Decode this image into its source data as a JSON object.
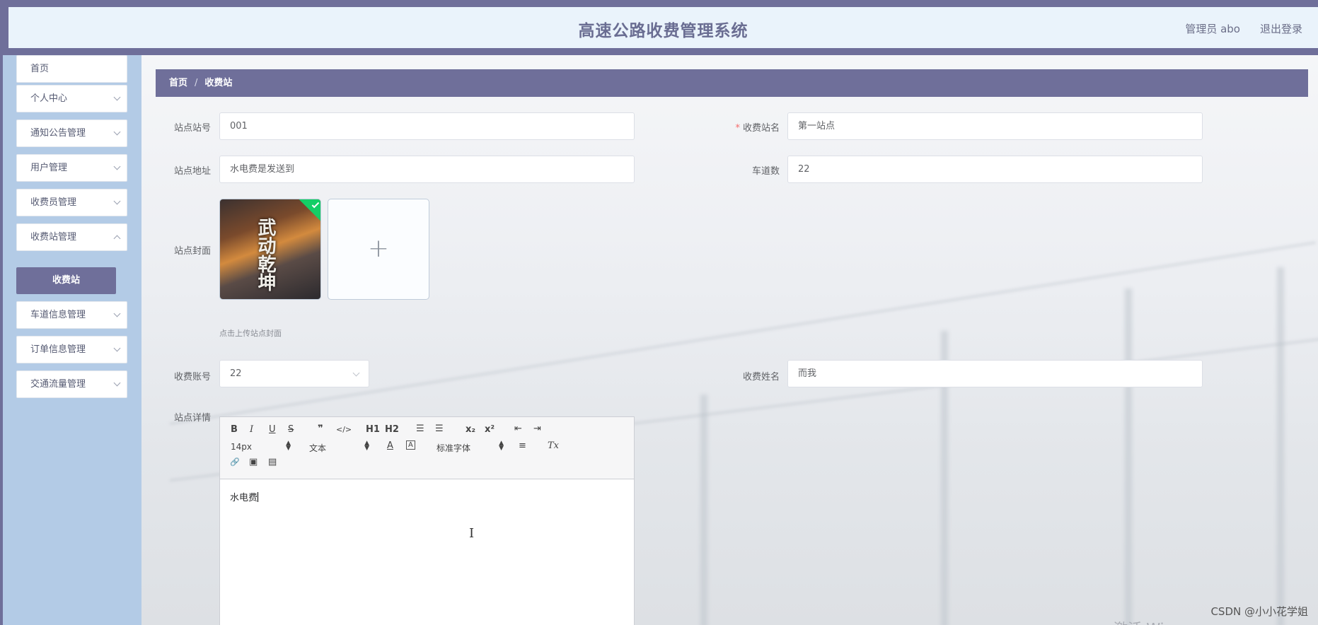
{
  "header": {
    "title": "高速公路收费管理系统",
    "user_label": "管理员 abo",
    "logout_label": "退出登录"
  },
  "sidebar": {
    "items": [
      {
        "label": "首页"
      },
      {
        "label": "个人中心"
      },
      {
        "label": "通知公告管理"
      },
      {
        "label": "用户管理"
      },
      {
        "label": "收费员管理"
      },
      {
        "label": "收费站管理"
      },
      {
        "label": "车道信息管理"
      },
      {
        "label": "订单信息管理"
      },
      {
        "label": "交通流量管理"
      }
    ],
    "active_submenu": "收费站"
  },
  "breadcrumb": {
    "home": "首页",
    "separator": "/",
    "current": "收费站"
  },
  "form": {
    "station_no": {
      "label": "站点站号",
      "value": "001"
    },
    "station_name": {
      "label": "收费站名",
      "value": "第一站点",
      "required_mark": "*"
    },
    "station_address": {
      "label": "站点地址",
      "value": "水电费是发送到"
    },
    "lane_count": {
      "label": "车道数",
      "value": "22"
    },
    "cover": {
      "label": "站点封面",
      "thumb_text": "武动乾坤",
      "tip": "点击上传站点封面",
      "add_icon": "+"
    },
    "toll_account": {
      "label": "收费账号",
      "value": "22"
    },
    "toll_name": {
      "label": "收费姓名",
      "value": "而我"
    },
    "details": {
      "label": "站点详情"
    }
  },
  "editor": {
    "toolbar": {
      "bold": "B",
      "italic": "I",
      "underline": "U",
      "strike": "S",
      "quote": "❞",
      "code": "</>",
      "h1": "H1",
      "h2": "H2",
      "ordered_list": "☰",
      "bullet_list": "☰",
      "sub": "x₂",
      "sup": "x²",
      "outdent": "⇤",
      "indent": "⇥",
      "size": "14px",
      "format": "文本",
      "color": "A",
      "background": "A",
      "font": "标准字体",
      "align": "≡",
      "clean": "Tx",
      "link": "🔗",
      "image": "▣",
      "video": "▤"
    },
    "content": "水电费"
  },
  "watermark": "CSDN @小小花学姐",
  "activate_text": "激活 Win",
  "icons": {
    "chevron": "chevron-down-icon",
    "upload_success": "check-icon",
    "upload_add": "plus-icon",
    "select_arrow": "chevron-down-icon",
    "text_cursor": "i-beam-cursor-icon"
  },
  "colors": {
    "primary": "#6f6f9a",
    "sidebar": "#b3cbe6",
    "header_bg": "#eaf3fb",
    "success": "#13ce66",
    "required": "#f56c6c"
  }
}
